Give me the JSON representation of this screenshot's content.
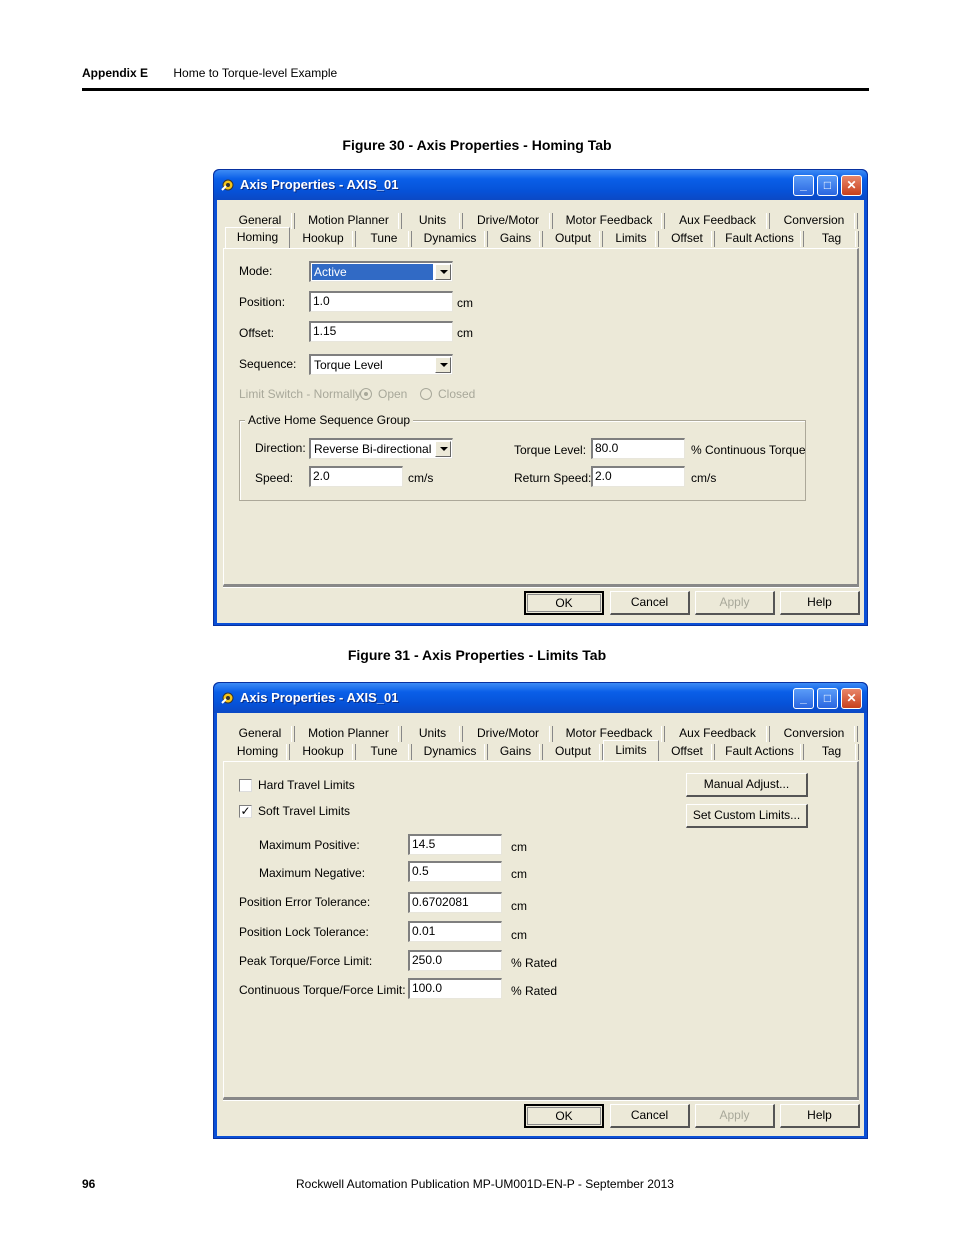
{
  "header": {
    "appendix": "Appendix E",
    "title": "Home to Torque-level Example"
  },
  "figure30": {
    "caption": "Figure 30 - Axis Properties - Homing Tab"
  },
  "figure31": {
    "caption": "Figure 31 - Axis Properties - Limits Tab"
  },
  "window": {
    "title": "Axis Properties - AXIS_01"
  },
  "tabs": {
    "row1": [
      "General",
      "Motion Planner",
      "Units",
      "Drive/Motor",
      "Motor Feedback",
      "Aux Feedback",
      "Conversion"
    ],
    "row2": [
      "Homing",
      "Hookup",
      "Tune",
      "Dynamics",
      "Gains",
      "Output",
      "Limits",
      "Offset",
      "Fault Actions",
      "Tag"
    ]
  },
  "homing": {
    "mode_label": "Mode:",
    "mode_value": "Active",
    "position_label": "Position:",
    "position_value": "1.0",
    "position_unit": "cm",
    "offset_label": "Offset:",
    "offset_value": "1.15",
    "offset_unit": "cm",
    "sequence_label": "Sequence:",
    "sequence_value": "Torque Level",
    "limit_switch_label": "Limit Switch - Normally:",
    "open_label": "Open",
    "closed_label": "Closed",
    "group_title": "Active Home Sequence Group",
    "direction_label": "Direction:",
    "direction_value": "Reverse Bi-directional",
    "speed_label": "Speed:",
    "speed_value": "2.0",
    "speed_unit": "cm/s",
    "torque_label": "Torque Level:",
    "torque_value": "80.0",
    "torque_unit": "% Continuous Torque",
    "return_speed_label": "Return Speed:",
    "return_speed_value": "2.0",
    "return_speed_unit": "cm/s"
  },
  "limits": {
    "hard_travel_label": "Hard Travel Limits",
    "hard_travel_checked": false,
    "soft_travel_label": "Soft Travel Limits",
    "soft_travel_checked": true,
    "check_mark": "✓",
    "manual_adjust": "Manual Adjust...",
    "set_custom": "Set Custom Limits...",
    "max_pos_label": "Maximum Positive:",
    "max_pos_value": "14.5",
    "max_pos_unit": "cm",
    "max_neg_label": "Maximum Negative:",
    "max_neg_value": "0.5",
    "max_neg_unit": "cm",
    "pos_err_label": "Position Error Tolerance:",
    "pos_err_value": "0.6702081",
    "pos_err_unit": "cm",
    "pos_lock_label": "Position Lock Tolerance:",
    "pos_lock_value": "0.01",
    "pos_lock_unit": "cm",
    "peak_torque_label": "Peak Torque/Force Limit:",
    "peak_torque_value": "250.0",
    "peak_torque_unit": "% Rated",
    "cont_torque_label": "Continuous Torque/Force Limit:",
    "cont_torque_value": "100.0",
    "cont_torque_unit": "% Rated"
  },
  "buttons": {
    "ok": "OK",
    "cancel": "Cancel",
    "apply": "Apply",
    "help": "Help"
  },
  "footer": {
    "page": "96",
    "publication": "Rockwell Automation Publication MP-UM001D-EN-P - September 2013"
  }
}
